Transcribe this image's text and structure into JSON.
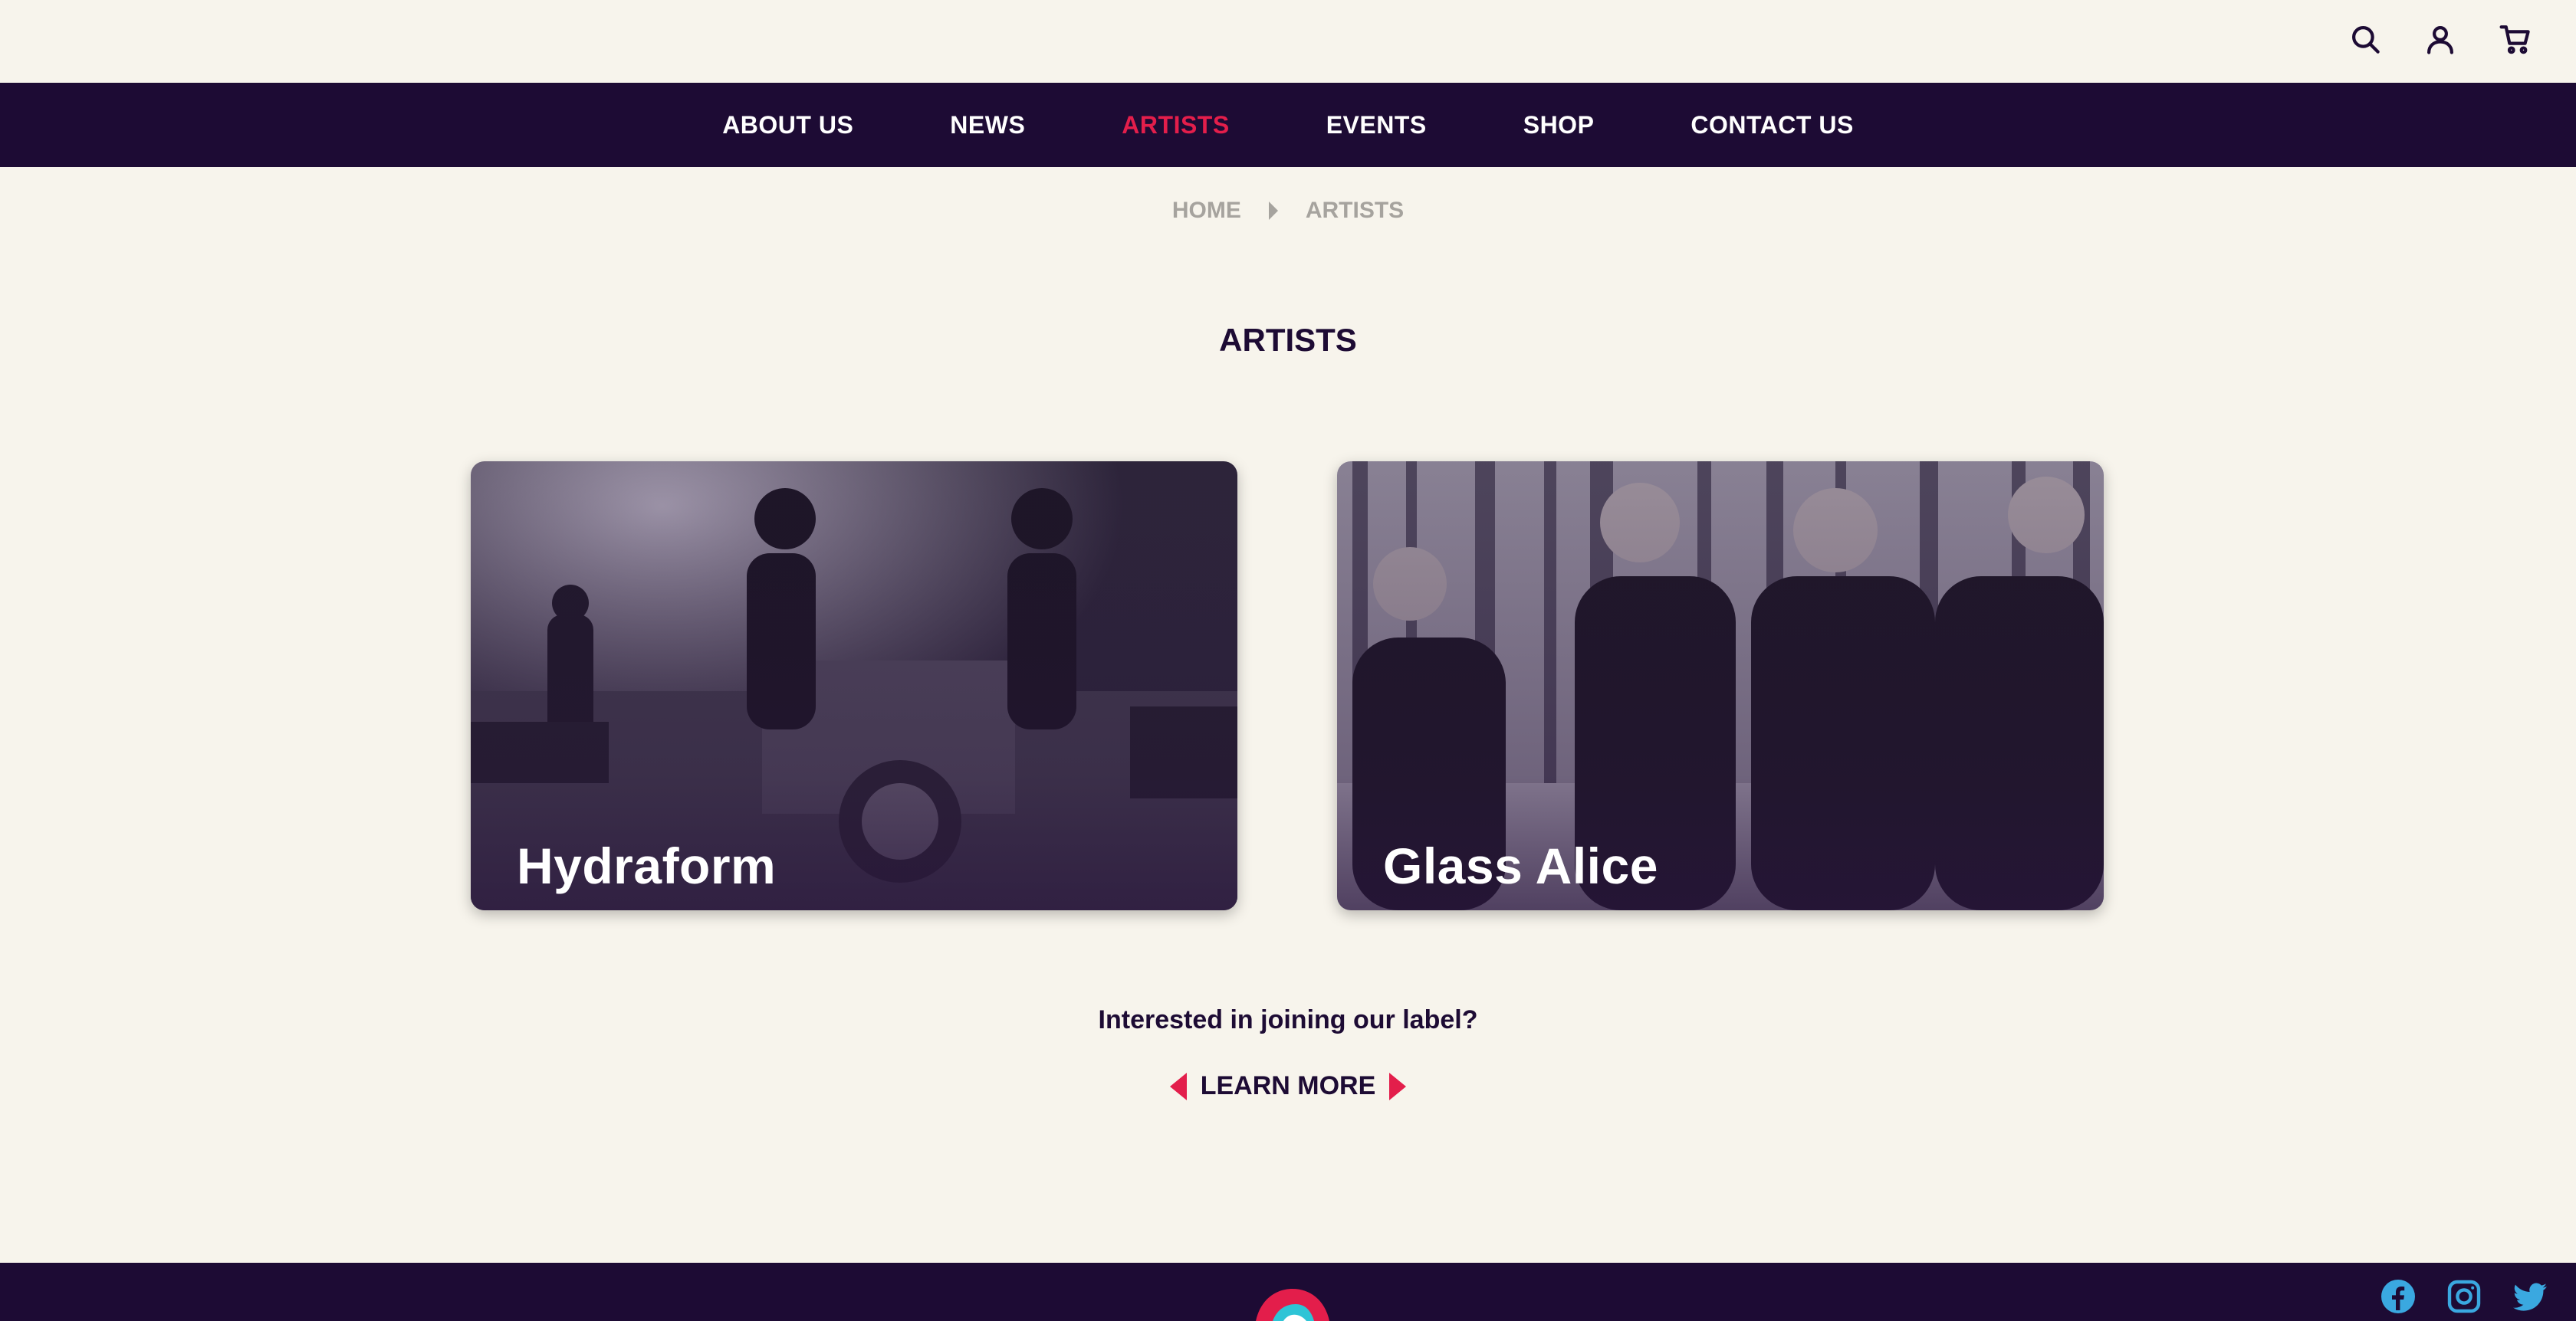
{
  "header": {
    "icons": [
      "search-icon",
      "user-icon",
      "cart-icon"
    ]
  },
  "nav": {
    "items": [
      {
        "label": "ABOUT US"
      },
      {
        "label": "NEWS"
      },
      {
        "label": "ARTISTS",
        "active": true
      },
      {
        "label": "EVENTS"
      },
      {
        "label": "SHOP"
      },
      {
        "label": "CONTACT US"
      }
    ]
  },
  "breadcrumb": {
    "home": "HOME",
    "current": "ARTISTS"
  },
  "page": {
    "title": "ARTISTS"
  },
  "artists": [
    {
      "name": "Hydraform"
    },
    {
      "name": "Glass Alice"
    }
  ],
  "cta": {
    "question": "Interested in joining our label?",
    "link": "LEARN MORE"
  },
  "footer": {
    "social": [
      "facebook-icon",
      "instagram-icon",
      "twitter-icon"
    ]
  },
  "colors": {
    "background": "#f7f4ec",
    "nav": "#1d0b34",
    "accent": "#e31e4b"
  }
}
